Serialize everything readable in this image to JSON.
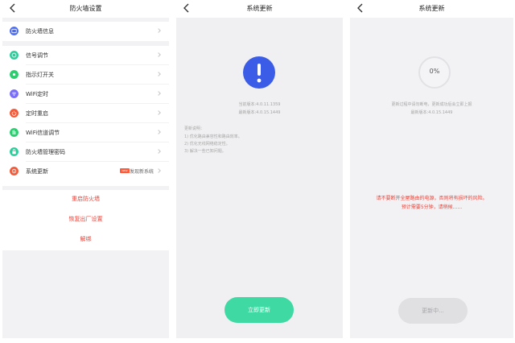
{
  "screen1": {
    "title": "防火墙设置",
    "info_item": {
      "label": "防火墙信息",
      "icon": "info-card-icon",
      "color": "#4a6cf7"
    },
    "items": [
      {
        "label": "信号调节",
        "icon": "signal-icon",
        "color": "#2ecc9a"
      },
      {
        "label": "指示灯开关",
        "icon": "indicator-light-icon",
        "color": "#2ecc71"
      },
      {
        "label": "WiFi定时",
        "icon": "wifi-timer-icon",
        "color": "#7b6ef6"
      },
      {
        "label": "定时重启",
        "icon": "power-icon",
        "color": "#f05a3a"
      },
      {
        "label": "WiFi信道调节",
        "icon": "channel-icon",
        "color": "#2ecc71"
      },
      {
        "label": "防火墙管理密码",
        "icon": "lock-icon",
        "color": "#2ecc9a"
      },
      {
        "label": "系统更新",
        "icon": "update-icon",
        "color": "#f05a3a",
        "badge": "NEW",
        "note": "发现新系统"
      }
    ],
    "actions": [
      "重启防火墙",
      "恢复出厂设置",
      "解绑"
    ],
    "action_color": "#e8453b"
  },
  "screen2": {
    "title": "系统更新",
    "current_version": "当前版本:4.0.11.1359",
    "latest_version": "最新版本:4.0.15.1449",
    "notes_title": "更新说明：",
    "notes": [
      "1) 优化路由兼容性和路由效率。",
      "2) 优化无线网络稳定性。",
      "3) 解决一些已知问题。"
    ],
    "button": "立即更新",
    "accent": "#3fd9a4",
    "icon_color": "#3a5ce6"
  },
  "screen3": {
    "title": "系统更新",
    "progress": "0%",
    "progress_fraction": 0,
    "status_line": "更新过程中请勿断电，更新成功后会立即上报",
    "latest_version": "最新版本:4.0.15.1449",
    "warning_line1": "请不要断开全屋路由的电源，否则将有损坏的风险。",
    "warning_line2": "预计需要5分钟，请稍候......",
    "button": "更新中..."
  }
}
